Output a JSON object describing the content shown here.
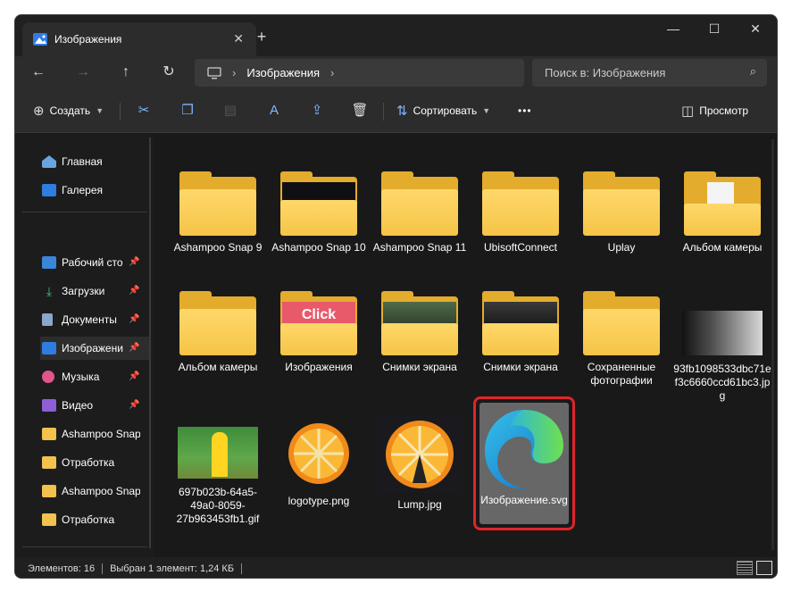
{
  "tab": {
    "title": "Изображения",
    "close": "✕",
    "new": "+"
  },
  "window_controls": {
    "minimize": "—",
    "maximize": "☐",
    "close": "✕"
  },
  "nav": {
    "back": "←",
    "forward": "→",
    "up": "↑",
    "refresh": "↻",
    "breadcrumb": [
      "Изображения"
    ],
    "search_placeholder": "Поиск в: Изображения"
  },
  "toolbar": {
    "create_label": "Создать",
    "sort_label": "Сортировать",
    "more": "•••",
    "preview_label": "Просмотр"
  },
  "sidebar": {
    "items": [
      {
        "label": "Главная",
        "icon": "home-icon",
        "pinned": false
      },
      {
        "label": "Галерея",
        "icon": "gallery-icon",
        "pinned": false
      },
      {
        "label": "Рабочий сто",
        "icon": "desktop-icon",
        "pinned": true
      },
      {
        "label": "Загрузки",
        "icon": "download-icon",
        "pinned": true
      },
      {
        "label": "Документы",
        "icon": "documents-icon",
        "pinned": true
      },
      {
        "label": "Изображени",
        "icon": "pictures-icon",
        "pinned": true,
        "selected": true
      },
      {
        "label": "Музыка",
        "icon": "music-icon",
        "pinned": true
      },
      {
        "label": "Видео",
        "icon": "video-icon",
        "pinned": true
      },
      {
        "label": "Ashampoo Snap",
        "icon": "folder-icon",
        "pinned": false
      },
      {
        "label": "Отработка",
        "icon": "folder-icon",
        "pinned": false
      },
      {
        "label": "Ashampoo Snap",
        "icon": "folder-icon",
        "pinned": false
      },
      {
        "label": "Отработка",
        "icon": "folder-icon",
        "pinned": false
      }
    ]
  },
  "files": [
    {
      "name": "Ashampoo Snap 9",
      "type": "folder"
    },
    {
      "name": "Ashampoo Snap 10",
      "type": "folder-preview-dark"
    },
    {
      "name": "Ashampoo Snap 11",
      "type": "folder"
    },
    {
      "name": "UbisoftConnect",
      "type": "folder"
    },
    {
      "name": "Uplay",
      "type": "folder"
    },
    {
      "name": "Альбом камеры",
      "type": "folder-preview-doc"
    },
    {
      "name": "Альбом камеры",
      "type": "folder"
    },
    {
      "name": "Изображения",
      "type": "folder-preview-click",
      "preview_text": "Click"
    },
    {
      "name": "Снимки экрана",
      "type": "folder-preview-photo"
    },
    {
      "name": "Снимки экрана",
      "type": "folder-preview-photo-dark"
    },
    {
      "name": "Сохраненные фотографии",
      "type": "folder"
    },
    {
      "name": "93fb1098533dbc71ef3c6660ccd61bc3.jpg",
      "type": "image-bw"
    },
    {
      "name": "697b023b-64a5-49a0-8059-27b963453fb1.gif",
      "type": "image-cartoon"
    },
    {
      "name": "logotype.png",
      "type": "image-orange"
    },
    {
      "name": "Lump.jpg",
      "type": "image-orange-dark"
    },
    {
      "name": "Изображение.svg",
      "type": "image-edge",
      "selected": true
    }
  ],
  "status": {
    "count": "Элементов: 16",
    "selected": "Выбран 1 элемент: 1,24 КБ"
  }
}
